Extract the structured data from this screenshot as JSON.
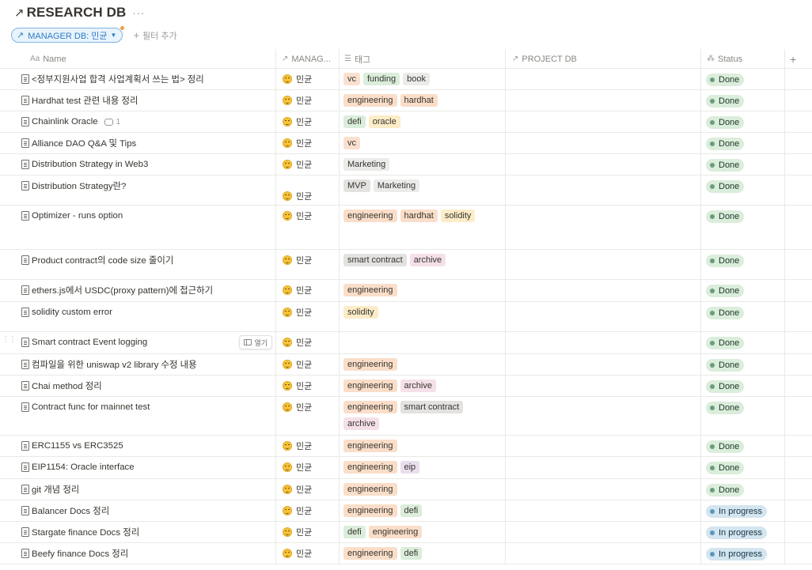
{
  "page": {
    "title": "RESEARCH DB",
    "title_icon": "arrow-up-right-icon",
    "more_label": "···"
  },
  "filters": {
    "active_label": "MANAGER DB: 민균",
    "add_label": "필터 추가"
  },
  "open_label": "열기",
  "columns": [
    {
      "key": "name",
      "label": "Name",
      "icon": "Aa"
    },
    {
      "key": "manager",
      "label": "MANAG...",
      "icon": "↗"
    },
    {
      "key": "tags",
      "label": "태그",
      "icon": "☰"
    },
    {
      "key": "project",
      "label": "PROJECT DB",
      "icon": "↗"
    },
    {
      "key": "status",
      "label": "Status",
      "icon": "⁂"
    },
    {
      "key": "add",
      "label": "+",
      "icon": ""
    }
  ],
  "tag_colors": {
    "vc": "#fbe0d0",
    "funding": "#dbeddb",
    "book": "#ebebe9",
    "engineering": "#fadec9",
    "hardhat": "#fadec9",
    "defi": "#dbeddb",
    "oracle": "#fdecc8",
    "Marketing": "#ebebe9",
    "MVP": "#e3e2e0",
    "solidity": "#fdecc8",
    "smart contract": "#e3e2e0",
    "archive": "#f5e0e9",
    "eip": "#e8deee"
  },
  "status_styles": {
    "Done": {
      "bg": "#dbeddb",
      "dot": "#6c9b7d",
      "text": "#1c3829"
    },
    "In progress": {
      "bg": "#d3e5ef",
      "dot": "#5b97bd",
      "text": "#183347"
    }
  },
  "rows": [
    {
      "name": "<정부지원사업 합격 사업계획서 쓰는 법> 정리",
      "manager": "민균",
      "tags": [
        "vc",
        "funding",
        "book"
      ],
      "status": "Done"
    },
    {
      "name": "Hardhat test 관련 내용 정리",
      "manager": "민균",
      "tags": [
        "engineering",
        "hardhat"
      ],
      "status": "Done"
    },
    {
      "name": "Chainlink Oracle",
      "comments": "1",
      "manager": "민균",
      "tags": [
        "defi",
        "oracle"
      ],
      "status": "Done"
    },
    {
      "name": "Alliance DAO Q&A 및 Tips",
      "manager": "민균",
      "tags": [
        "vc"
      ],
      "status": "Done"
    },
    {
      "name": "Distribution Strategy in Web3",
      "manager": "민균",
      "tags": [
        "Marketing"
      ],
      "status": "Done"
    },
    {
      "name": "Distribution Strategy란?",
      "manager": "민균",
      "tags": [
        "MVP",
        "Marketing"
      ],
      "status": "Done"
    },
    {
      "name": "Optimizer - runs option",
      "manager": "민균",
      "tags": [
        "engineering",
        "hardhat",
        "solidity"
      ],
      "status": "Done"
    },
    {
      "name": "Product contract의 code size 줄이기",
      "manager": "민균",
      "tags": [
        "smart contract",
        "archive"
      ],
      "status": "Done"
    },
    {
      "name": "ethers.js에서 USDC(proxy pattern)에 접근하기",
      "manager": "민균",
      "tags": [
        "engineering"
      ],
      "status": "Done"
    },
    {
      "name": "solidity custom error",
      "manager": "민균",
      "tags": [
        "solidity"
      ],
      "status": "Done"
    },
    {
      "name": "Smart contract Event logging",
      "manager": "민균",
      "tags": [],
      "status": "Done",
      "hover": true
    },
    {
      "name": "컴파일을 위한 uniswap v2 library 수정 내용",
      "manager": "민균",
      "tags": [
        "engineering"
      ],
      "status": "Done"
    },
    {
      "name": "Chai method 정리",
      "manager": "민균",
      "tags": [
        "engineering",
        "archive"
      ],
      "status": "Done"
    },
    {
      "name": "Contract func for mainnet test",
      "manager": "민균",
      "tags": [
        "engineering",
        "smart contract",
        "archive"
      ],
      "status": "Done"
    },
    {
      "name": "ERC1155 vs ERC3525",
      "manager": "민균",
      "tags": [
        "engineering"
      ],
      "status": "Done"
    },
    {
      "name": "EIP1154: Oracle interface",
      "manager": "민균",
      "tags": [
        "engineering",
        "eip"
      ],
      "status": "Done"
    },
    {
      "name": "git 개념 정리",
      "manager": "민균",
      "tags": [
        "engineering"
      ],
      "status": "Done"
    },
    {
      "name": "Balancer Docs 정리",
      "manager": "민균",
      "tags": [
        "engineering",
        "defi"
      ],
      "status": "In progress"
    },
    {
      "name": "Stargate finance Docs 정리",
      "manager": "민균",
      "tags": [
        "defi",
        "engineering"
      ],
      "status": "In progress"
    },
    {
      "name": "Beefy finance Docs 정리",
      "manager": "민균",
      "tags": [
        "engineering",
        "defi"
      ],
      "status": "In progress"
    }
  ]
}
